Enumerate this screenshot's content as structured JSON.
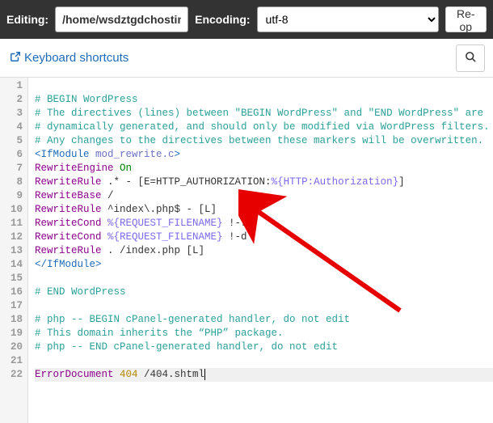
{
  "topbar": {
    "editing_label": "Editing:",
    "path_value": "/home/wsdztgdchosting/p",
    "encoding_label": "Encoding:",
    "encoding_value": "utf-8",
    "reopen_label": "Re-op"
  },
  "subbar": {
    "keyboard_shortcuts": "Keyboard shortcuts"
  },
  "editor": {
    "line_numbers": [
      "1",
      "2",
      "3",
      "4",
      "5",
      "6",
      "7",
      "8",
      "9",
      "10",
      "11",
      "12",
      "13",
      "14",
      "15",
      "16",
      "17",
      "18",
      "19",
      "20",
      "21",
      "22"
    ],
    "lines": {
      "l1": "",
      "l2": "# BEGIN WordPress",
      "l3": "# The directives (lines) between \"BEGIN WordPress\" and \"END WordPress\" are",
      "l4": "# dynamically generated, and should only be modified via WordPress filters.",
      "l5": "# Any changes to the directives between these markers will be overwritten.",
      "l6_open": "<IfModule",
      "l6_attr": " mod_rewrite.c",
      "l6_close": ">",
      "l7_k": "RewriteEngine",
      "l7_v": " On",
      "l8_k": "RewriteRule",
      "l8_rest": " .* - [E=HTTP_AUTHORIZATION:",
      "l8_var": "%{HTTP:Authorization}",
      "l8_end": "]",
      "l9_k": "RewriteBase",
      "l9_v": " /",
      "l10_k": "RewriteRule",
      "l10_v": " ^index\\.php$ - [L]",
      "l11_k": "RewriteCond",
      "l11_var": " %{REQUEST_FILENAME}",
      "l11_v": " !-f",
      "l12_k": "RewriteCond",
      "l12_var": " %{REQUEST_FILENAME}",
      "l12_v": " !-d",
      "l13_k": "RewriteRule",
      "l13_v": " . /index.php [L]",
      "l14": "</IfModule>",
      "l15": "",
      "l16": "# END WordPress",
      "l17": "",
      "l18": "# php -- BEGIN cPanel-generated handler, do not edit",
      "l19": "# This domain inherits the “PHP” package.",
      "l20": "# php -- END cPanel-generated handler, do not edit",
      "l21": "",
      "l22_k": "ErrorDocument",
      "l22_n": " 404",
      "l22_v": " /404.shtml"
    }
  },
  "icons": {
    "external": "external-link-icon",
    "search": "search-icon"
  }
}
